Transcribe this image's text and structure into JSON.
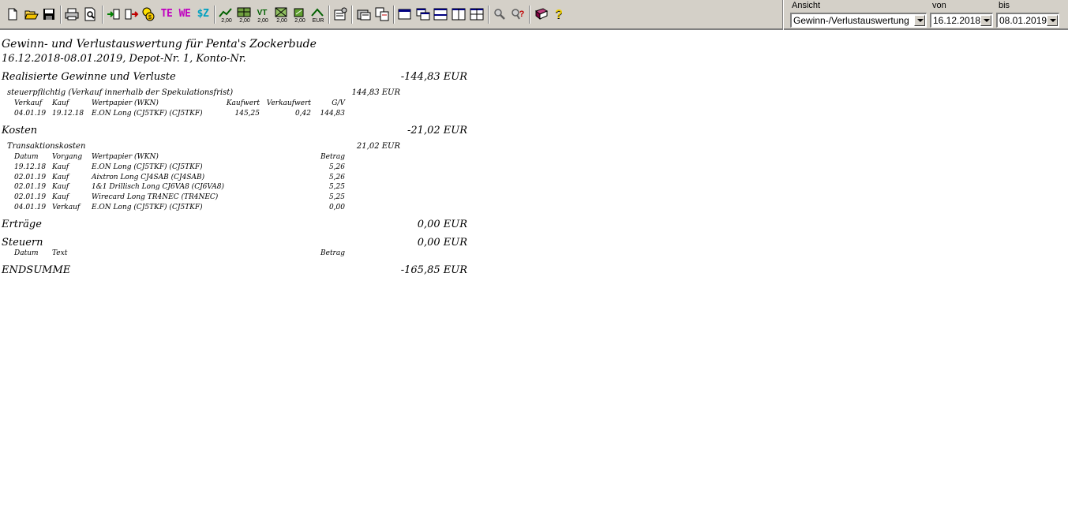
{
  "toolbar": {
    "ansicht_label": "Ansicht",
    "ansicht_value": "Gewinn-/Verlustauswertung",
    "von_label": "von",
    "von_value": "16.12.2018",
    "bis_label": "bis",
    "bis_value": "08.01.2019",
    "btn_te": "TE",
    "btn_we": "WE",
    "btn_sz": "$Z",
    "value_200": "2,00",
    "value_eur": "EUR"
  },
  "report": {
    "title": "Gewinn- und Verlustauswertung für Penta's Zockerbude",
    "subtitle": "16.12.2018-08.01.2019, Depot-Nr. 1, Konto-Nr.",
    "realized": {
      "label": "Realisierte Gewinne und Verluste",
      "total": "-144,83 EUR",
      "group_label": "steuerpflichtig (Verkauf innerhalb der Spekulationsfrist)",
      "group_total": "144,83 EUR",
      "headers": {
        "verkauf": "Verkauf",
        "kauf": "Kauf",
        "wp": "Wertpapier (WKN)",
        "kaufwert": "Kaufwert",
        "verkaufwert": "Verkaufwert",
        "gv": "G/V"
      },
      "rows": [
        {
          "verkauf": "04.01.19",
          "kauf": "19.12.18",
          "wp": "E.ON Long (CJ5TKF) (CJ5TKF)",
          "kaufwert": "145,25",
          "verkaufwert": "0,42",
          "gv": "144,83"
        }
      ]
    },
    "kosten": {
      "label": "Kosten",
      "total": "-21,02 EUR",
      "group_label": "Transaktionskosten",
      "group_total": "21,02 EUR",
      "headers": {
        "datum": "Datum",
        "vorgang": "Vorgang",
        "wp": "Wertpapier (WKN)",
        "betrag": "Betrag"
      },
      "rows": [
        {
          "datum": "19.12.18",
          "vorgang": "Kauf",
          "wp": "E.ON Long (CJ5TKF) (CJ5TKF)",
          "betrag": "5,26"
        },
        {
          "datum": "02.01.19",
          "vorgang": "Kauf",
          "wp": "Aixtron Long CJ4SAB (CJ4SAB)",
          "betrag": "5,26"
        },
        {
          "datum": "02.01.19",
          "vorgang": "Kauf",
          "wp": "1&1 Drillisch Long CJ6VA8 (CJ6VA8)",
          "betrag": "5,25"
        },
        {
          "datum": "02.01.19",
          "vorgang": "Kauf",
          "wp": "Wirecard Long TR4NEC (TR4NEC)",
          "betrag": "5,25"
        },
        {
          "datum": "04.01.19",
          "vorgang": "Verkauf",
          "wp": "E.ON Long (CJ5TKF) (CJ5TKF)",
          "betrag": "0,00"
        }
      ]
    },
    "ertraege": {
      "label": "Erträge",
      "total": "0,00 EUR"
    },
    "steuern": {
      "label": "Steuern",
      "total": "0,00 EUR",
      "headers": {
        "datum": "Datum",
        "text": "Text",
        "betrag": "Betrag"
      }
    },
    "endsumme": {
      "label": "ENDSUMME",
      "total": "-165,85 EUR"
    }
  }
}
